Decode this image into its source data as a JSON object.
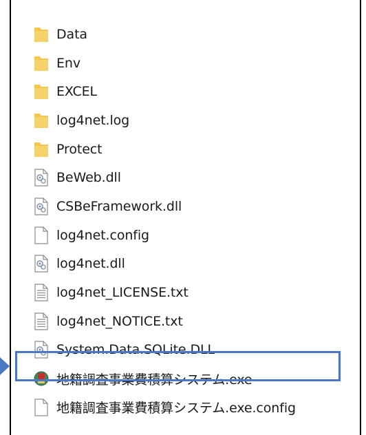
{
  "file_list": {
    "items": [
      {
        "name": "Data",
        "icon": "folder-icon"
      },
      {
        "name": "Env",
        "icon": "folder-icon"
      },
      {
        "name": "EXCEL",
        "icon": "folder-icon"
      },
      {
        "name": "log4net.log",
        "icon": "folder-icon"
      },
      {
        "name": "Protect",
        "icon": "folder-icon"
      },
      {
        "name": "BeWeb.dll",
        "icon": "dll-file-icon"
      },
      {
        "name": "CSBeFramework.dll",
        "icon": "dll-file-icon"
      },
      {
        "name": "log4net.config",
        "icon": "blank-file-icon"
      },
      {
        "name": "log4net.dll",
        "icon": "dll-file-icon"
      },
      {
        "name": "log4net_LICENSE.txt",
        "icon": "text-file-icon"
      },
      {
        "name": "log4net_NOTICE.txt",
        "icon": "text-file-icon"
      },
      {
        "name": "System.Data.SQLite.DLL",
        "icon": "dll-file-icon"
      },
      {
        "name": "地籍調査事業費積算システム.exe",
        "icon": "app-exe-icon",
        "selected": true
      },
      {
        "name": "地籍調査事業費積算システム.exe.config",
        "icon": "blank-file-icon"
      }
    ]
  },
  "colors": {
    "folder": "#f3c74e",
    "highlight": "#4a78c5",
    "frame": "#000000"
  }
}
